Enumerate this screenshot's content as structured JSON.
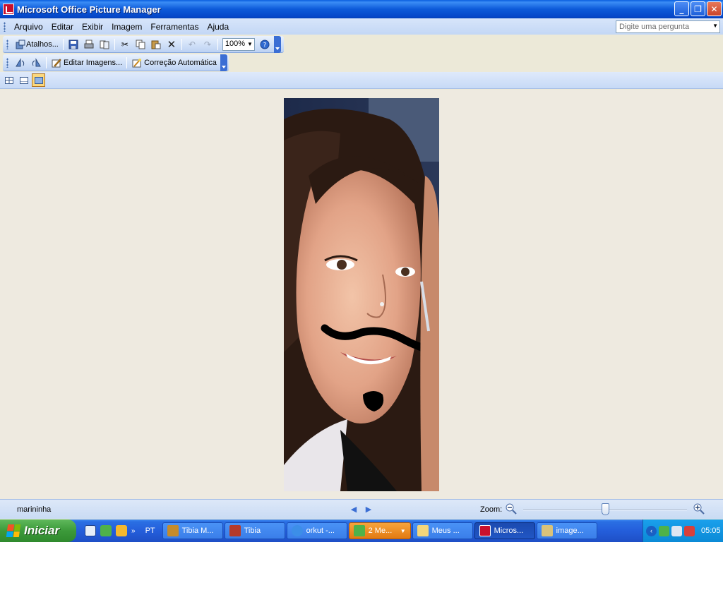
{
  "window": {
    "title": "Microsoft Office Picture Manager"
  },
  "menu": {
    "items": [
      "Arquivo",
      "Editar",
      "Exibir",
      "Imagem",
      "Ferramentas",
      "Ajuda"
    ],
    "help_placeholder": "Digite uma pergunta"
  },
  "toolbar1": {
    "shortcuts_label": "Atalhos...",
    "zoom_value": "100%"
  },
  "toolbar2": {
    "edit_label": "Editar Imagens...",
    "autocorrect_label": "Correção Automática"
  },
  "status": {
    "filename": "marininha",
    "zoom_label": "Zoom:",
    "zoom_level_fraction": 0.5
  },
  "taskbar": {
    "start_label": "Iniciar",
    "language": "PT",
    "tasks": [
      {
        "label": "Tibia M...",
        "icon": "tibia-maps-icon",
        "state": "normal"
      },
      {
        "label": "Tibia",
        "icon": "tibia-icon",
        "state": "normal"
      },
      {
        "label": "orkut -...",
        "icon": "internet-explorer-icon",
        "state": "normal"
      },
      {
        "label": "2 Me...",
        "icon": "msn-messenger-icon",
        "state": "flash"
      },
      {
        "label": "Meus ...",
        "icon": "folder-icon",
        "state": "normal"
      },
      {
        "label": "Micros...",
        "icon": "picture-manager-icon",
        "state": "active"
      },
      {
        "label": "image...",
        "icon": "paint-icon",
        "state": "normal"
      }
    ],
    "clock": "05:05"
  },
  "colors": {
    "titlebar": "#0d5ad9",
    "taskbar": "#245edb",
    "start": "#3c9a3a",
    "tray": "#0b8ad6",
    "canvas": "#eeeae0"
  }
}
